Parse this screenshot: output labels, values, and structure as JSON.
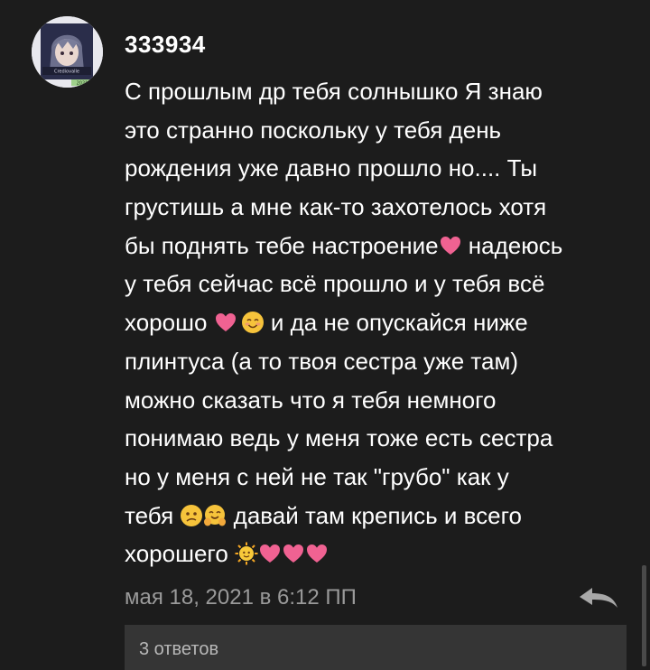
{
  "comment": {
    "username": "333934",
    "avatar_caption": "Crediovalle",
    "avatar_badge": "2021",
    "lines": [
      "С прошлым др тебя солнышко Я знаю",
      "это странно поскольку у тебя день",
      "рождения уже давно прошло но.... Ты",
      "грустишь а мне как-то захотелось хотя",
      "бы поднять тебе настроение",
      " надеюсь",
      "у тебя сейчас всё прошло и у тебя всё",
      "хорошо ",
      " и да не опускайся ниже",
      "плинтуса (а то твоя сестра уже там)",
      "можно сказать что я тебя немного",
      "понимаю ведь у меня тоже есть сестра",
      "но у меня с ней не так \"грубо\" как у",
      "тебя ",
      " давай там крепись и всего",
      "хорошего "
    ],
    "emoji": [
      "heart-icon",
      "heart-icon",
      "smiling-face-icon",
      "confused-face-icon",
      "hugging-face-icon",
      "sun-face-icon",
      "heart-icon",
      "heart-icon",
      "heart-icon"
    ],
    "timestamp": "мая 18, 2021 в 6:12 ПП",
    "reply_icon": "reply-arrow-icon",
    "replies_label": "3 ответов"
  },
  "colors": {
    "background": "#1c1c1c",
    "text": "#ffffff",
    "muted": "#9a9a9a",
    "heart": "#f06292",
    "replies_bg": "#353535"
  }
}
